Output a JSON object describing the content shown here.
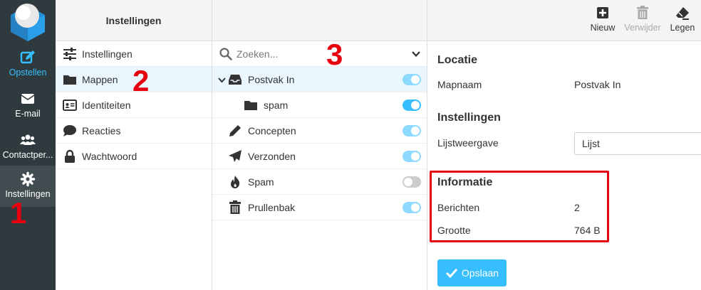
{
  "taskbar": {
    "items": [
      {
        "label": "Opstellen",
        "icon": "compose-icon"
      },
      {
        "label": "E-mail",
        "icon": "envelope-icon"
      },
      {
        "label": "Contactper...",
        "icon": "users-icon"
      },
      {
        "label": "Instellingen",
        "icon": "gear-icon"
      }
    ],
    "accent": "#37beff",
    "background": "#2f3a3f"
  },
  "settings": {
    "title": "Instellingen",
    "items": [
      {
        "label": "Instellingen",
        "icon": "sliders-icon"
      },
      {
        "label": "Mappen",
        "icon": "folder-icon"
      },
      {
        "label": "Identiteiten",
        "icon": "id-card-icon"
      },
      {
        "label": "Reacties",
        "icon": "comment-icon"
      },
      {
        "label": "Wachtwoord",
        "icon": "lock-icon"
      }
    ]
  },
  "folders": {
    "search_placeholder": "Zoeken...",
    "items": [
      {
        "label": "Postvak In",
        "icon": "inbox-icon",
        "subscribed": true
      },
      {
        "label": "spam",
        "icon": "folder-icon",
        "subscribed": true
      },
      {
        "label": "Concepten",
        "icon": "pencil-icon",
        "subscribed": true
      },
      {
        "label": "Verzonden",
        "icon": "paper-plane-icon",
        "subscribed": true
      },
      {
        "label": "Spam",
        "icon": "fire-icon",
        "subscribed": false
      },
      {
        "label": "Prullenbak",
        "icon": "trash-icon",
        "subscribed": true
      }
    ]
  },
  "toolbar": {
    "new_label": "Nieuw",
    "delete_label": "Verwijder",
    "clear_label": "Legen"
  },
  "detail": {
    "location_title": "Locatie",
    "folder_name_label": "Mapnaam",
    "folder_name_value": "Postvak In",
    "settings_title": "Instellingen",
    "list_view_label": "Lijstweergave",
    "list_view_value": "Lijst",
    "info_title": "Informatie",
    "messages_label": "Berichten",
    "messages_value": "2",
    "size_label": "Grootte",
    "size_value": "764 B",
    "save_label": "Opslaan"
  },
  "annotations": {
    "one": "1",
    "two": "2",
    "three": "3",
    "color": "#e8000e"
  }
}
